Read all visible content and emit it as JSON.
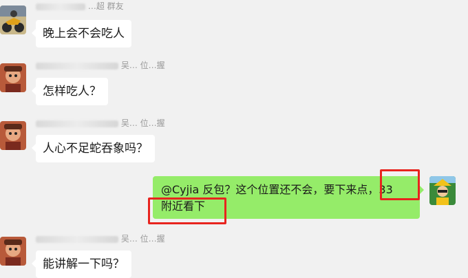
{
  "messages": [
    {
      "sender_visible": "…超 群友",
      "text": "晚上会不会吃人"
    },
    {
      "sender_visible": "吴… 位…握",
      "text": "怎样吃人？"
    },
    {
      "sender_visible": "吴… 位…握",
      "text": "人心不足蛇吞象吗？"
    },
    {
      "sender_visible": "吴… 位…握",
      "text": "能讲解一下吗？"
    }
  ],
  "my_message": {
    "line1": "@Cyjia 反包？这个位置还不会，要下来点，33",
    "line2": "附近看下"
  },
  "colors": {
    "background": "#f1f1f1",
    "incoming_bubble": "#ffffff",
    "outgoing_bubble": "#95ec69",
    "highlight_box": "#e8241e"
  },
  "icons": {
    "avatar_1": "motorcycle-avatar-icon",
    "avatar_2": "cartoon-character-avatar-icon",
    "avatar_3": "yellow-hat-character-avatar-icon"
  }
}
